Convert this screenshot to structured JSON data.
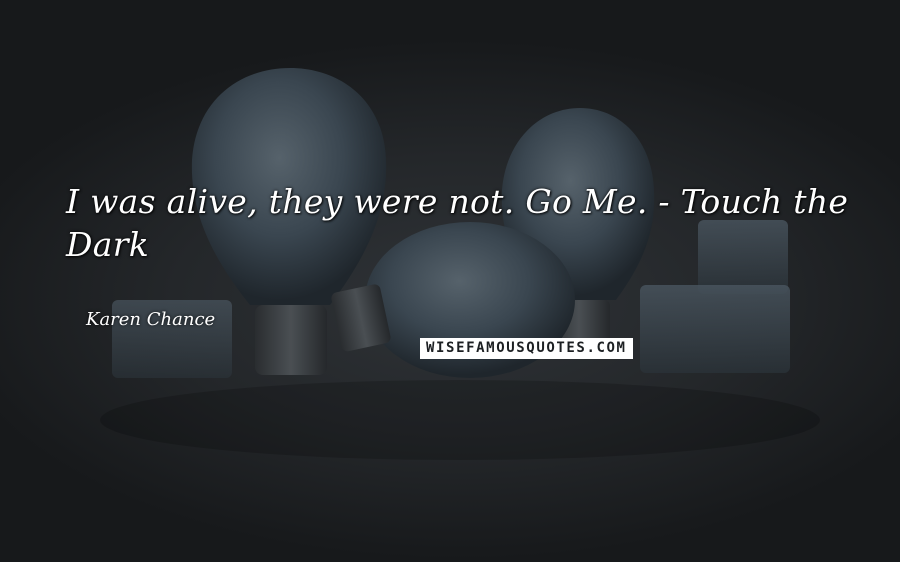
{
  "quote": {
    "text": "I was alive, they were not. Go Me. - Touch the Dark",
    "author": "Karen Chance"
  },
  "watermark": {
    "text": "WISEFAMOUSQUOTES.COM"
  },
  "colors": {
    "background": "#1c1f22",
    "text": "#ffffff",
    "bulb_glass": "#3a4650"
  }
}
